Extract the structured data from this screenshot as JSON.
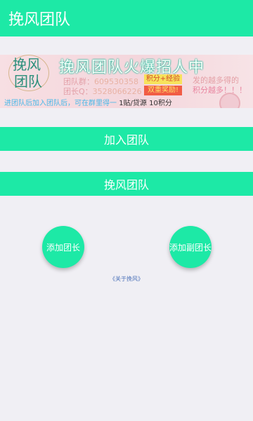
{
  "header": {
    "title": "挽风团队"
  },
  "banner": {
    "logo_text_1": "挽风",
    "logo_text_2": "团队",
    "headline": "挽风团队火爆招人中",
    "line1_label": "团队群：",
    "line1_value": "609530358",
    "line2_label": "团长Q：",
    "line2_value": "3528066226",
    "tag_yellow": "积分+经验",
    "tag_red": "双重奖励!",
    "side_line1": "发的越多得的",
    "side_line2": "积分越多！！！",
    "bottom_blue": "进团队后加入团队后，可在群里得一",
    "bottom_dark": "1贴/贷源 10积分"
  },
  "join_button": {
    "label": "加入团队"
  },
  "team_bar": {
    "label": "挽风团队"
  },
  "circles": {
    "add_leader": "添加团长",
    "add_vice_leader": "添加副团长"
  },
  "about_link": "《关于挽风》",
  "colors": {
    "accent": "#1de9a6",
    "background": "#f0eff4",
    "link": "#4a70b8"
  }
}
